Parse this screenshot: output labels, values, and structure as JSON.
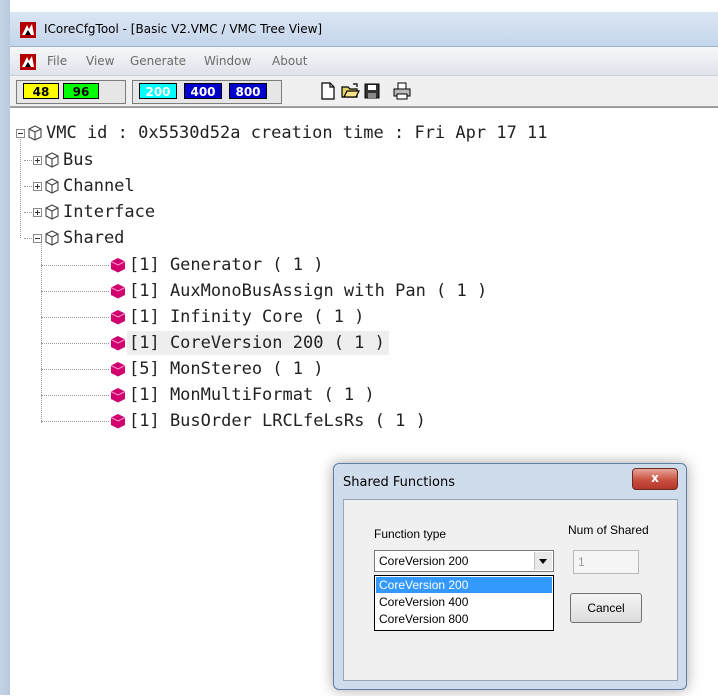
{
  "window": {
    "title": "ICoreCfgTool - [Basic V2.VMC / VMC Tree View]"
  },
  "menu": {
    "items": [
      {
        "label": "File"
      },
      {
        "label": "View"
      },
      {
        "label": "Generate"
      },
      {
        "label": "Window"
      },
      {
        "label": "About"
      }
    ]
  },
  "toolbar": {
    "sample_rates": [
      "48",
      "96"
    ],
    "versions": [
      "200",
      "400",
      "800"
    ],
    "icons": [
      "new-document-icon",
      "open-folder-icon",
      "save-icon",
      "print-icon"
    ],
    "colors": {
      "yellow": "#ffff00",
      "green": "#00ff00",
      "cyan": "#00ffff",
      "blue": "#0000ff"
    }
  },
  "tree": {
    "root": "VMC id : 0x5530d52a creation time : Fri Apr 17 11",
    "groups": [
      "Bus",
      "Channel",
      "Interface",
      "Shared"
    ],
    "shared_items": [
      "[1] Generator ( 1 )",
      "[1] AuxMonoBusAssign with Pan ( 1 )",
      "[1] Infinity Core ( 1 )",
      "[1] CoreVersion 200 ( 1 )",
      "[5] MonStereo ( 1 )",
      "[1] MonMultiFormat ( 1 )",
      "[1] BusOrder LRCLfeLsRs ( 1 )"
    ],
    "selected_item": "[1] CoreVersion 200 ( 1 )"
  },
  "dialog": {
    "title": "Shared Functions",
    "close_label": "x",
    "function_type_label": "Function type",
    "num_shared_label": "Num of Shared",
    "selected_function": "CoreVersion 200",
    "options": [
      "CoreVersion 200",
      "CoreVersion 400",
      "CoreVersion 800"
    ],
    "num_shared_value": "1",
    "cancel_label": "Cancel"
  }
}
